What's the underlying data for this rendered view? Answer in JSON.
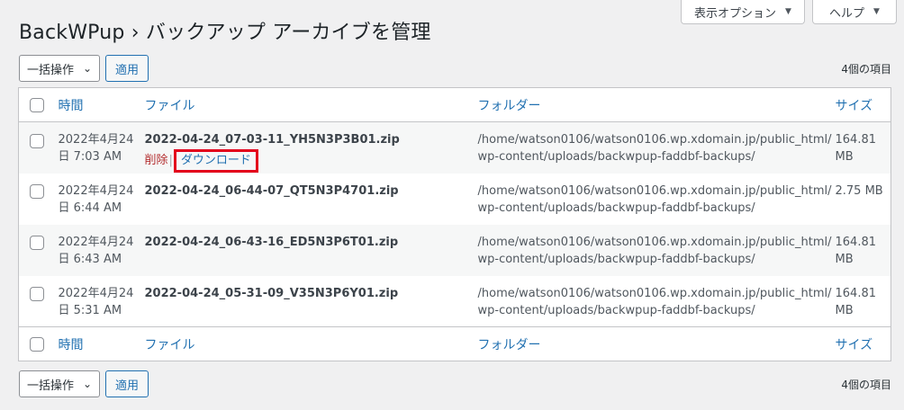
{
  "screen_meta": {
    "options_label": "表示オプション",
    "help_label": "ヘルプ"
  },
  "page": {
    "title": "BackWPup › バックアップ アーカイブを管理"
  },
  "tablenav_top": {
    "bulk_action": "一括操作",
    "apply": "適用",
    "count": "4個の項目"
  },
  "tablenav_bottom": {
    "bulk_action": "一括操作",
    "apply": "適用",
    "count": "4個の項目"
  },
  "columns": {
    "time": "時間",
    "file": "ファイル",
    "folder": "フォルダー",
    "size": "サイズ"
  },
  "rows": [
    {
      "time_line1": "2022年4月24",
      "time_line2": "日 7:03 AM",
      "file": "2022-04-24_07-03-11_YH5N3P3B01.zip",
      "actions": {
        "delete": "削除",
        "sep": "|",
        "download": "ダウンロード"
      },
      "folder_line1": "/home/watson0106/watson0106.wp.xdomain.jp/public_html/",
      "folder_line2": "wp-content/uploads/backwpup-faddbf-backups/",
      "size": "164.81 MB"
    },
    {
      "time_line1": "2022年4月24",
      "time_line2": "日 6:44 AM",
      "file": "2022-04-24_06-44-07_QT5N3P4701.zip",
      "folder_line1": "/home/watson0106/watson0106.wp.xdomain.jp/public_html/",
      "folder_line2": "wp-content/uploads/backwpup-faddbf-backups/",
      "size": "2.75 MB"
    },
    {
      "time_line1": "2022年4月24",
      "time_line2": "日 6:43 AM",
      "file": "2022-04-24_06-43-16_ED5N3P6T01.zip",
      "folder_line1": "/home/watson0106/watson0106.wp.xdomain.jp/public_html/",
      "folder_line2": "wp-content/uploads/backwpup-faddbf-backups/",
      "size": "164.81 MB"
    },
    {
      "time_line1": "2022年4月24",
      "time_line2": "日 5:31 AM",
      "file": "2022-04-24_05-31-09_V35N3P6Y01.zip",
      "folder_line1": "/home/watson0106/watson0106.wp.xdomain.jp/public_html/",
      "folder_line2": "wp-content/uploads/backwpup-faddbf-backups/",
      "size": "164.81 MB"
    }
  ],
  "colors": {
    "link": "#2271b1",
    "delete": "#b32d2e",
    "highlight_box": "#e3001b",
    "background": "#f0f0f1"
  }
}
